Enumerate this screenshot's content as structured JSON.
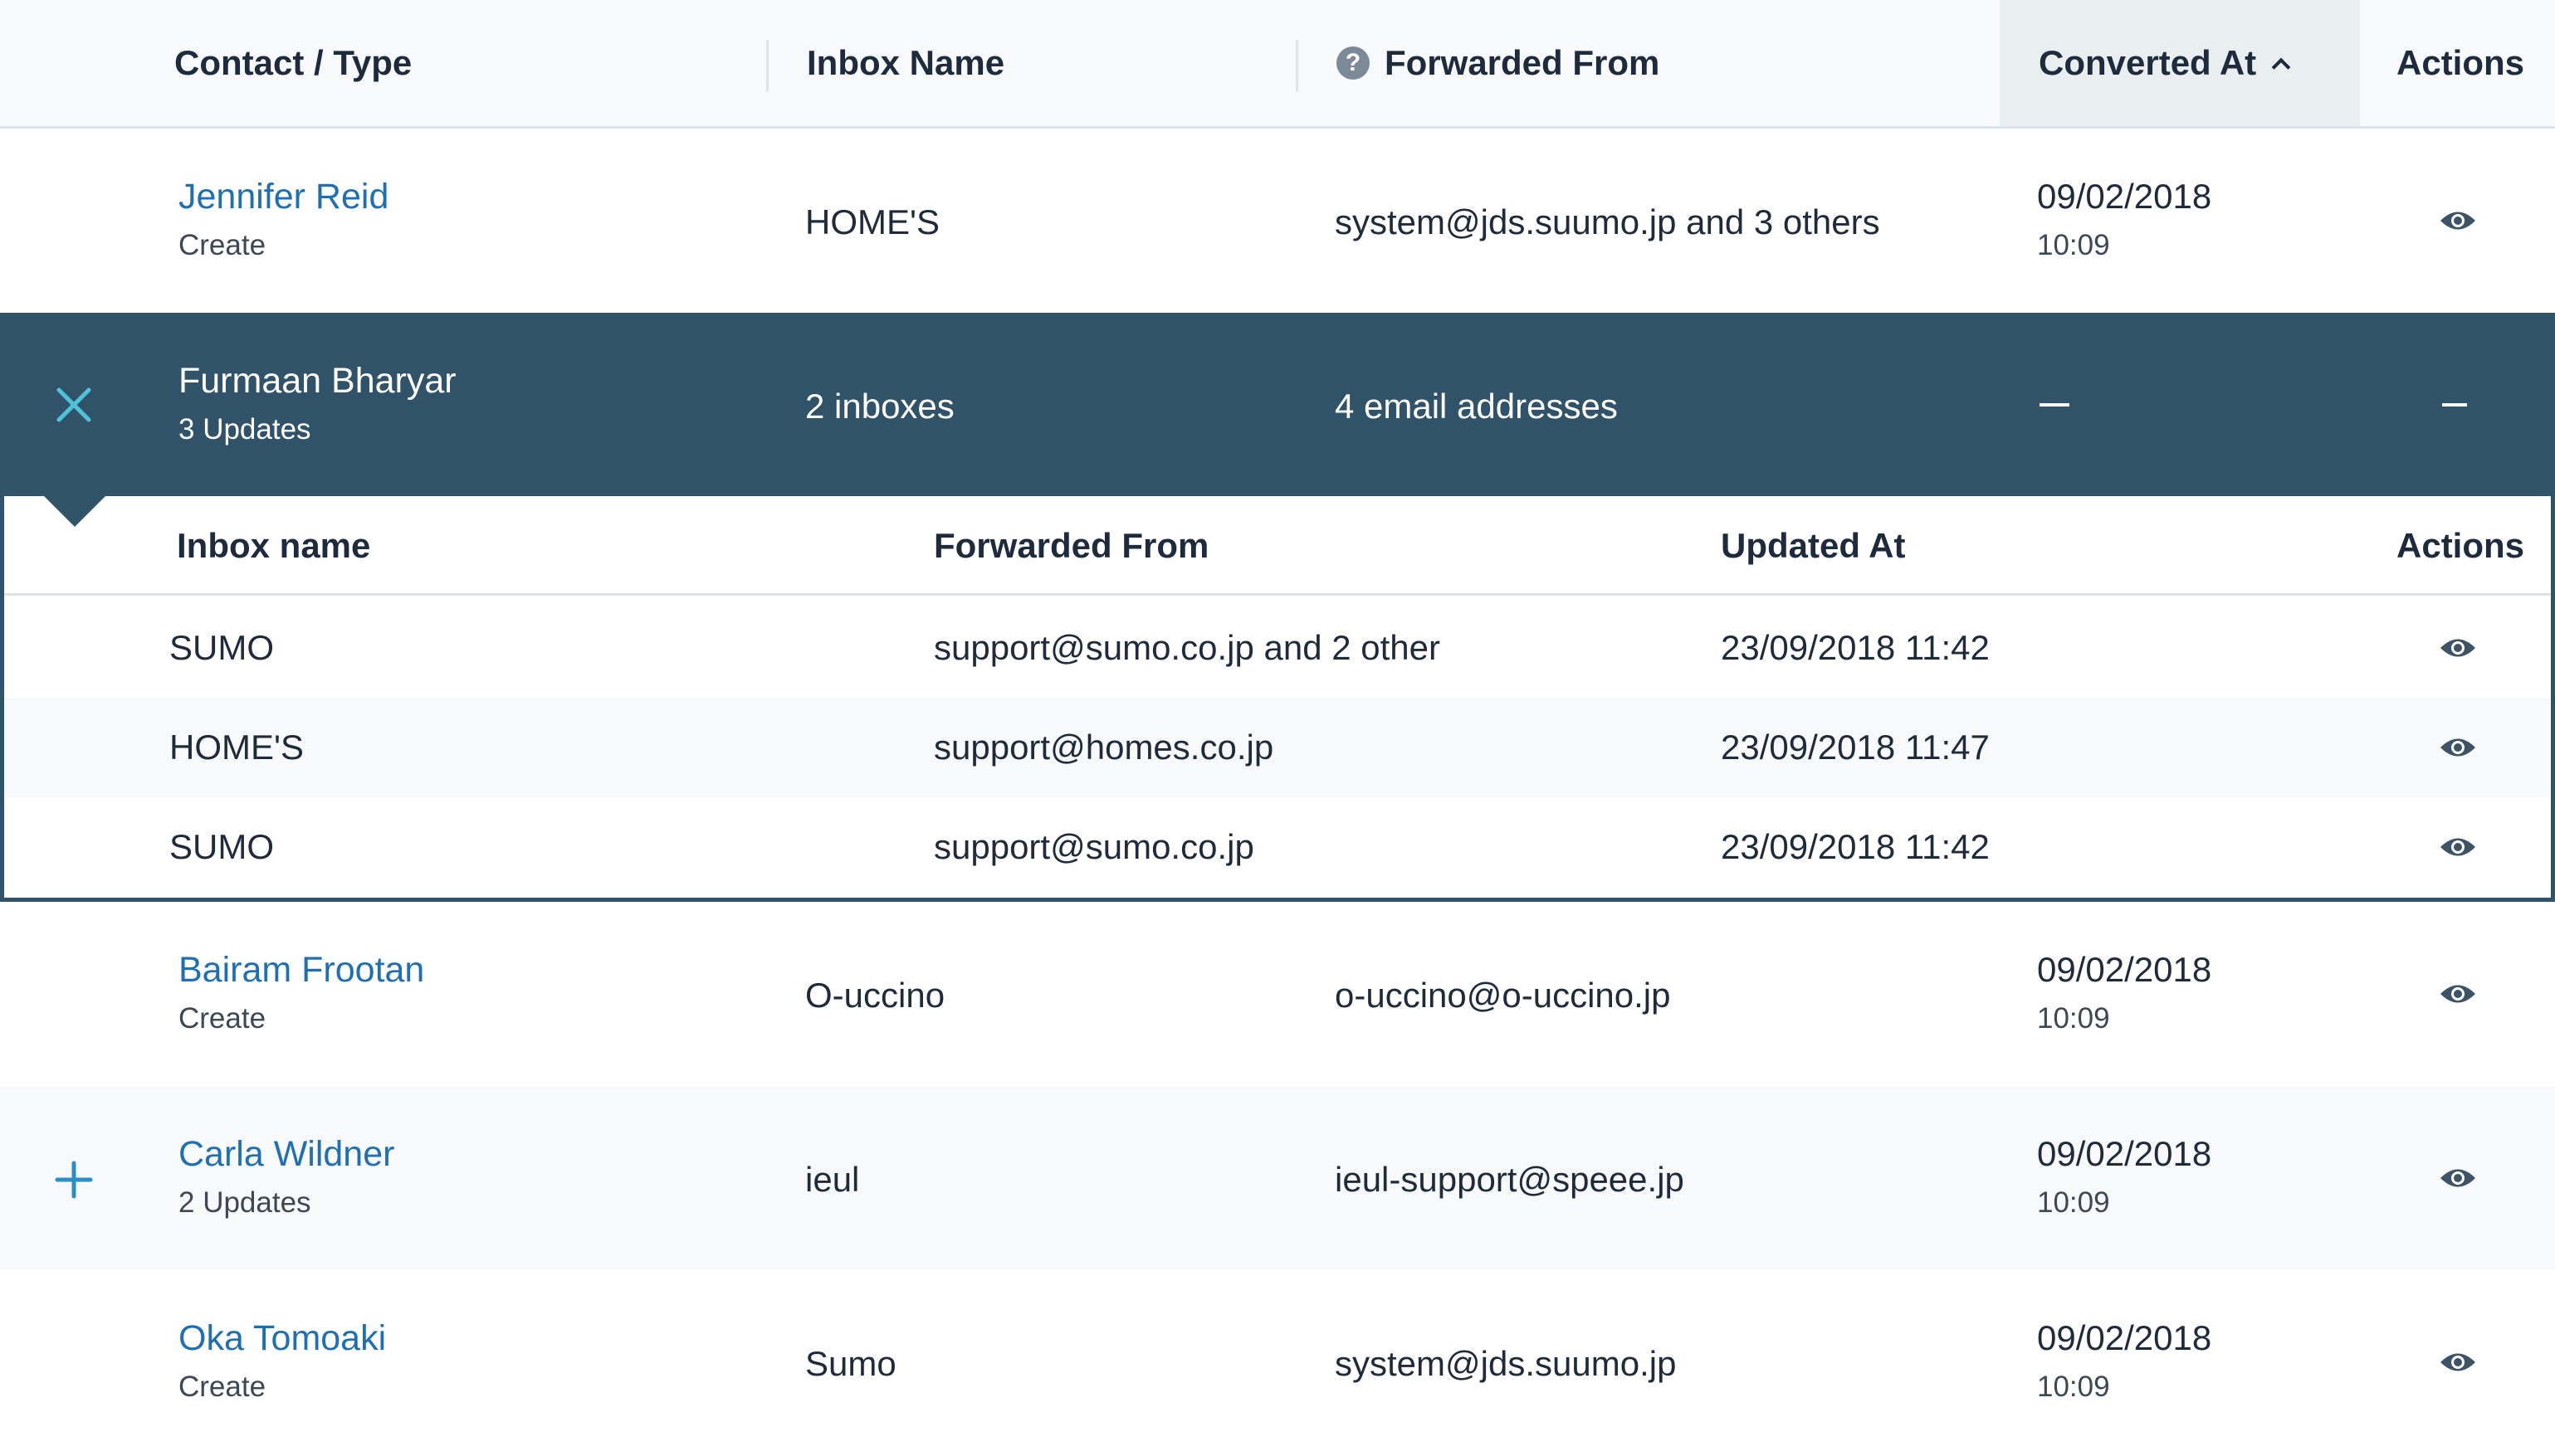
{
  "header": {
    "contact_type": "Contact / Type",
    "inbox_name": "Inbox Name",
    "forwarded_from": "Forwarded From",
    "converted_at": "Converted At",
    "actions": "Actions"
  },
  "rows": [
    {
      "name": "Jennifer Reid",
      "type": "Create",
      "inbox": "HOME'S",
      "forwarded": "system@jds.suumo.jp and 3 others",
      "date": "09/02/2018",
      "time": "10:09"
    },
    {
      "name": "Furmaan Bharyar",
      "type": "3 Updates",
      "inbox": "2 inboxes",
      "forwarded": "4 email addresses",
      "expanded": true
    },
    {
      "name": "Bairam Frootan",
      "type": "Create",
      "inbox": "O-uccino",
      "forwarded": "o-uccino@o-uccino.jp",
      "date": "09/02/2018",
      "time": "10:09"
    },
    {
      "name": "Carla Wildner",
      "type": "2 Updates",
      "inbox": "ieul",
      "forwarded": "ieul-support@speee.jp",
      "date": "09/02/2018",
      "time": "10:09"
    },
    {
      "name": "Oka Tomoaki",
      "type": "Create",
      "inbox": "Sumo",
      "forwarded": "system@jds.suumo.jp",
      "date": "09/02/2018",
      "time": "10:09"
    }
  ],
  "expanded": {
    "header": {
      "inbox_name": "Inbox name",
      "forwarded_from": "Forwarded From",
      "updated_at": "Updated At",
      "actions": "Actions"
    },
    "rows": [
      {
        "inbox": "SUMO",
        "forwarded": "support@sumo.co.jp and 2 other",
        "updated": "23/09/2018  11:42"
      },
      {
        "inbox": "HOME'S",
        "forwarded": "support@homes.co.jp",
        "updated": "23/09/2018  11:47"
      },
      {
        "inbox": "SUMO",
        "forwarded": "support@sumo.co.jp",
        "updated": "23/09/2018  11:42"
      }
    ]
  },
  "colors": {
    "link": "#1f6fb5",
    "expanded_bg": "#31536a",
    "expanded_link": "#4fc3d9",
    "icon_accent": "#2a8fc4"
  },
  "icons": {
    "collapse": "close-icon",
    "expand": "plus-icon",
    "view": "eye-icon",
    "help": "question-icon",
    "sort": "chevron-up-icon"
  }
}
